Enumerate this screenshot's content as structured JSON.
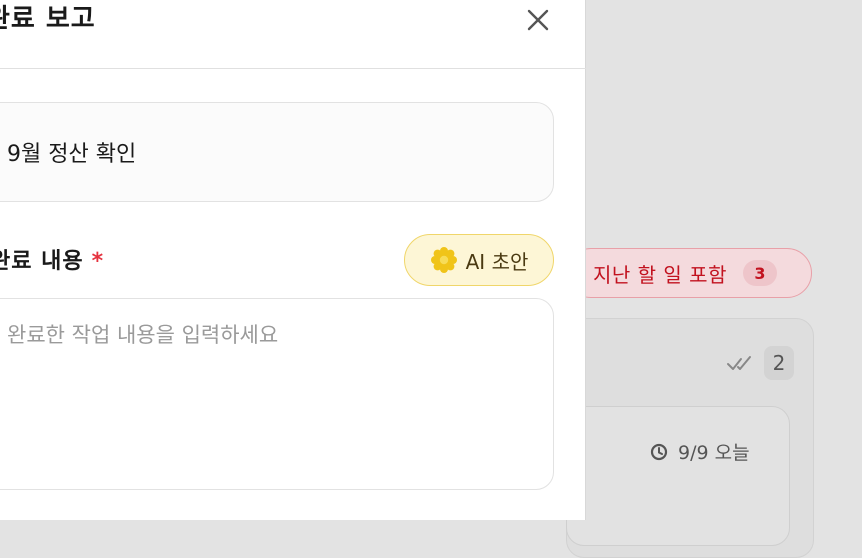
{
  "modal": {
    "title": "완료 보고",
    "task_title": "9월 정산 확인",
    "content_label": "완료 내용",
    "required_mark": "*",
    "ai_button_label": "AI 초안",
    "content_placeholder": "완료한 작업 내용을 입력하세요",
    "close_icon": "close-icon",
    "ai_icon": "sparkle-icon"
  },
  "background": {
    "overdue_filter_label": "지난 할 일 포함",
    "overdue_count": "3",
    "done_count": "2",
    "task_due": "9/9 오늘"
  },
  "colors": {
    "accent_red": "#c2121f",
    "ai_yellow": "#f0c419",
    "required_red": "#e5323f"
  }
}
